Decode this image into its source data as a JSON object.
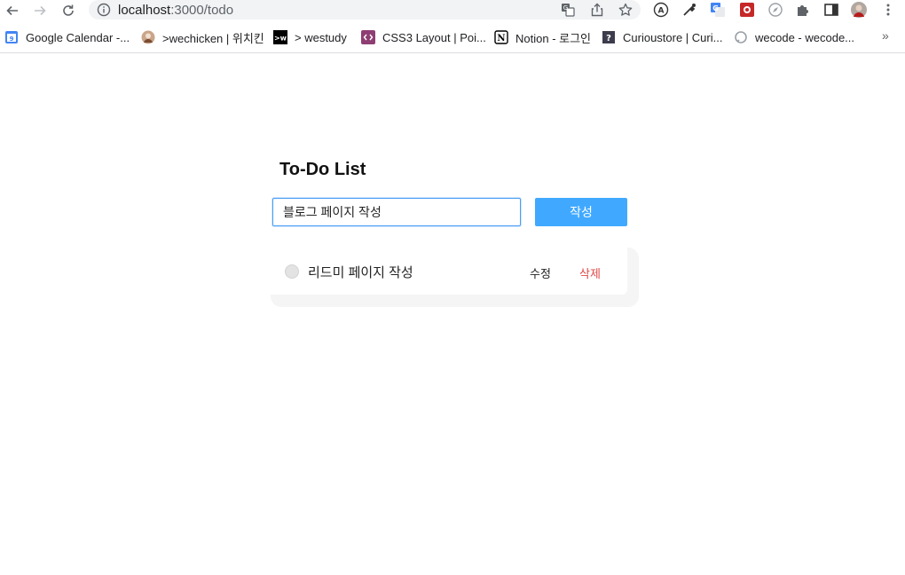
{
  "browser": {
    "url": {
      "host": "localhost",
      "path": ":3000/todo"
    },
    "bookmarks": [
      {
        "label": "Google Calendar -...",
        "icon": "google-calendar-icon"
      },
      {
        "label": ">wechicken | 위치킨",
        "icon": "wechicken-avatar-icon"
      },
      {
        "label": "> westudy",
        "icon": "westudy-icon"
      },
      {
        "label": "CSS3 Layout | Poi...",
        "icon": "css-layout-icon"
      },
      {
        "label": "Notion - 로그인",
        "icon": "notion-icon"
      },
      {
        "label": "Curioustore | Curi...",
        "icon": "curioustore-icon"
      },
      {
        "label": "wecode - wecode...",
        "icon": "wecode-icon"
      }
    ],
    "more_label": "»"
  },
  "app": {
    "title": "To-Do List",
    "input": {
      "value": "블로그 페이지 작성"
    },
    "submit_label": "작성",
    "todos": [
      {
        "text": "리드미 페이지 작성",
        "edit_label": "수정",
        "delete_label": "삭제"
      }
    ]
  },
  "colors": {
    "accent": "#40a9ff",
    "delete": "#e04848",
    "input_focus": "#4a9df8"
  }
}
